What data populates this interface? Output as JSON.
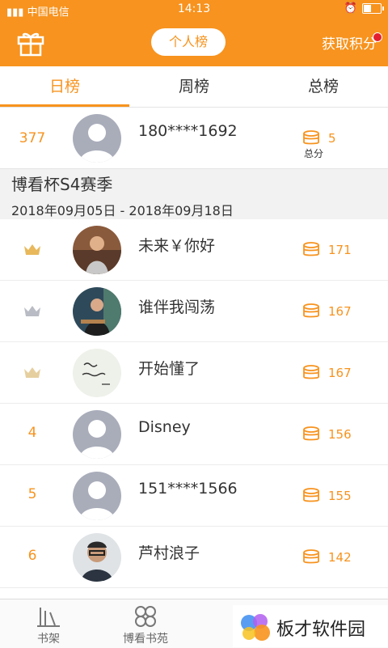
{
  "status_bar": {
    "carrier": "中国电信",
    "time": "14:13",
    "battery_level": 0.45
  },
  "header": {
    "title_button": "个人榜",
    "points_label": "获取积分",
    "points_has_notification": true
  },
  "tabs": [
    {
      "label": "日榜",
      "active": true
    },
    {
      "label": "周榜",
      "active": false
    },
    {
      "label": "总榜",
      "active": false
    }
  ],
  "my_rank": {
    "rank": "377",
    "name": "180****1692",
    "score": "5",
    "score_caption": "总分"
  },
  "season": {
    "title": "博看杯S4赛季",
    "dates": "2018年09月05日 - 2018年09月18日"
  },
  "leaderboard": [
    {
      "rank": "",
      "crown": "gold",
      "name": "未来￥你好",
      "score": "171",
      "avatar": "photo"
    },
    {
      "rank": "",
      "crown": "silver",
      "name": "谁伴我闯荡",
      "score": "167",
      "avatar": "photo"
    },
    {
      "rank": "",
      "crown": "bronze",
      "name": "开始懂了",
      "score": "167",
      "avatar": "calligraphy"
    },
    {
      "rank": "4",
      "crown": "",
      "name": "Disney",
      "score": "156",
      "avatar": "default"
    },
    {
      "rank": "5",
      "crown": "",
      "name": "151****1566",
      "score": "155",
      "avatar": "default"
    },
    {
      "rank": "6",
      "crown": "",
      "name": "芦村浪子",
      "score": "142",
      "avatar": "photo"
    }
  ],
  "bottom_nav": [
    {
      "label": "书架",
      "icon": "bookshelf-icon"
    },
    {
      "label": "博看书苑",
      "icon": "clover-icon"
    },
    {
      "label": "",
      "icon": "rank-icon",
      "active": true
    },
    {
      "label": "",
      "icon": "profile-icon"
    }
  ],
  "watermark": {
    "text": "板才软件园"
  },
  "colors": {
    "accent": "#f7931e",
    "background": "#ffffff",
    "section": "#f2f2f2",
    "badge": "#e5202e"
  }
}
